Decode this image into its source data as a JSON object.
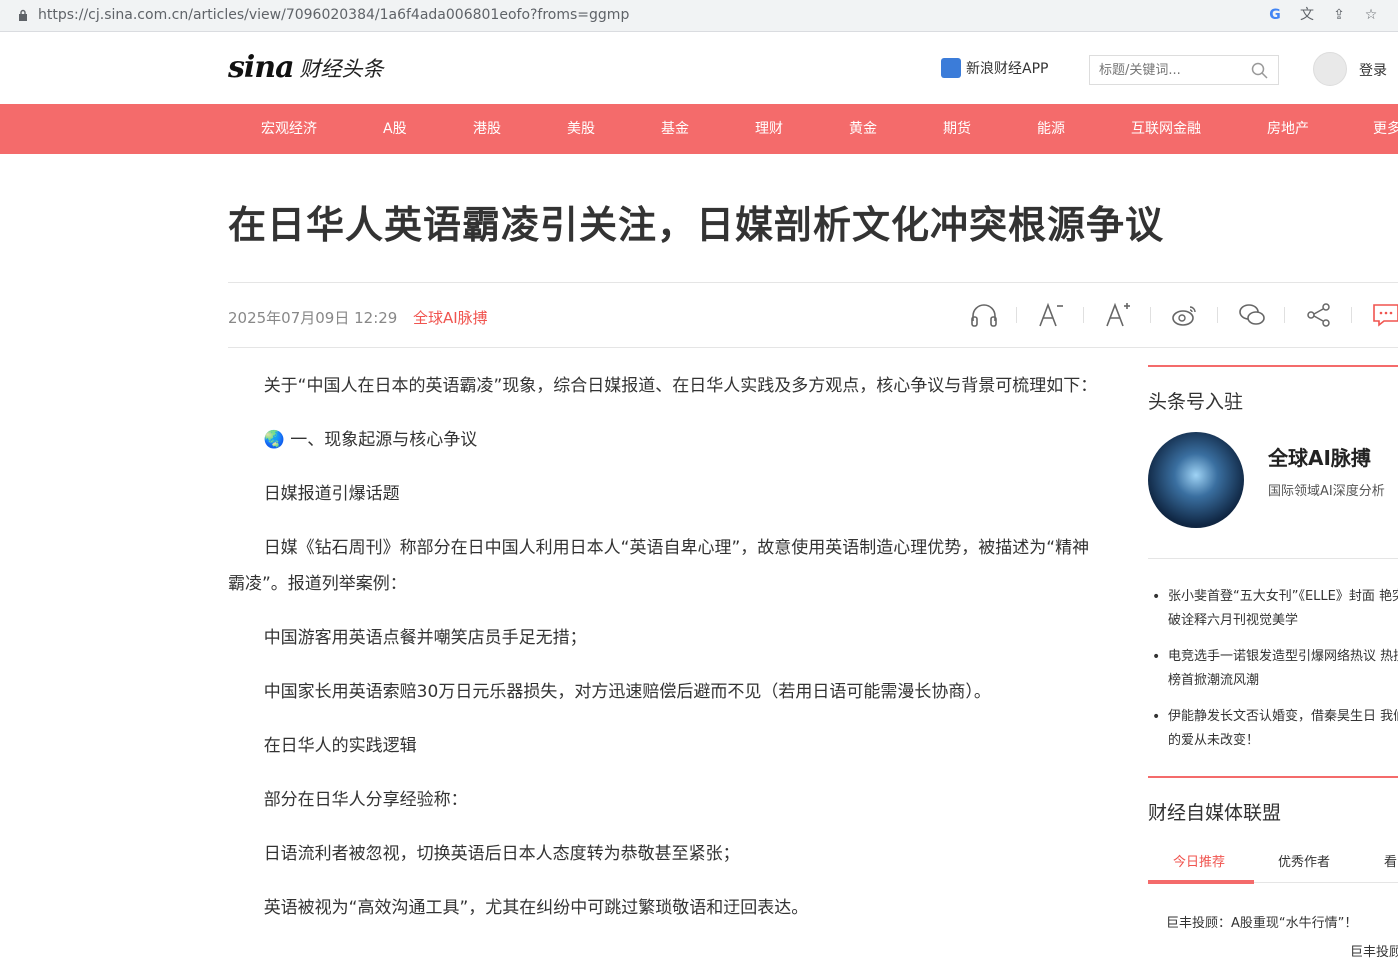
{
  "browser": {
    "url": "https://cj.sina.com.cn/articles/view/7096020384/1a6f4ada006801eofo?froms=ggmp",
    "icons": [
      "google-icon",
      "translate-icon",
      "share-icon",
      "star-icon"
    ]
  },
  "header": {
    "logo_text": "sina",
    "logo_sub": "财经头条",
    "app_label": "新浪财经APP",
    "search_placeholder": "标题/关键词...",
    "login_label": "登录"
  },
  "nav": {
    "items": [
      "宏观经济",
      "A股",
      "港股",
      "美股",
      "基金",
      "理财",
      "黄金",
      "期货",
      "能源",
      "互联网金融",
      "房地产",
      "更多"
    ]
  },
  "article": {
    "title": "在日华人英语霸凌引关注，日媒剖析文化冲突根源争议",
    "date": "2025年07月09日 12:29",
    "source": "全球AI脉搏",
    "tools": [
      "headphones-icon",
      "font-decrease-icon",
      "font-increase-icon",
      "weibo-icon",
      "wechat-icon",
      "share-icon",
      "comment-icon"
    ],
    "paragraphs": [
      "关于“中国人在日本的英语霸凌”现象，综合日媒报道、在日华人实践及多方观点，核心争议与背景可梳理如下：",
      "🌏 一、现象起源与核心争议",
      "日媒报道引爆话题",
      "日媒《钻石周刊》称部分在日中国人利用日本人“英语自卑心理”，故意使用英语制造心理优势，被描述为“精神霸凌”。报道列举案例：",
      "中国游客用英语点餐并嘲笑店员手足无措；",
      "中国家长用英语索赔30万日元乐器损失，对方迅速赔偿后避而不见（若用日语可能需漫长协商）。",
      "在日华人的实践逻辑",
      "部分在日华人分享经验称：",
      "日语流利者被忽视，切换英语后日本人态度转为恭敬甚至紧张；",
      "英语被视为“高效沟通工具”，尤其在纠纷中可跳过繁琐敬语和迂回表达。"
    ]
  },
  "sidebar": {
    "section1_title": "头条号入驻",
    "profile_name": "全球AI脉搏",
    "profile_desc": "国际领域AI深度分析",
    "news": [
      "张小斐首登“五大女刊”《ELLE》封面 艳突破诠释六月刊视觉美学",
      "电竞选手一诺银发造型引爆网络热议 热搜榜首掀潮流风潮",
      "伊能静发长文否认婚变，借秦昊生日 我们的爱从未改变！"
    ],
    "section2_title": "财经自媒体联盟",
    "tabs": [
      "今日推荐",
      "优秀作者",
      "看"
    ],
    "rec1": "巨丰投顾：A股重现“水牛行情”！",
    "rec2": "巨丰投顾"
  },
  "colors": {
    "accent": "#f46b6b",
    "source": "#f0544f"
  }
}
